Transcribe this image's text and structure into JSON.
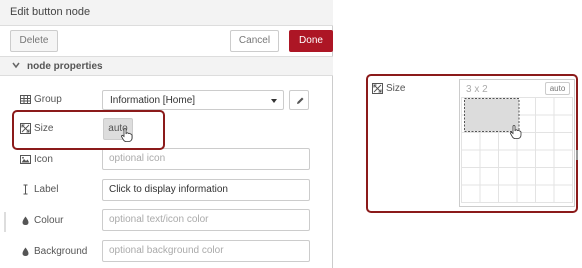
{
  "panel": {
    "title": "Edit button node",
    "delete_label": "Delete",
    "cancel_label": "Cancel",
    "done_label": "Done",
    "section_title": "node properties"
  },
  "properties": {
    "group": {
      "label": "Group",
      "value": "Information [Home]",
      "icon": "table-icon"
    },
    "size": {
      "label": "Size",
      "value": "auto",
      "icon": "size-grid-icon"
    },
    "icon": {
      "label": "Icon",
      "placeholder": "optional icon",
      "icon": "image-icon"
    },
    "label": {
      "label": "Label",
      "value": "Click to display information",
      "icon": "text-cursor-icon"
    },
    "colour": {
      "label": "Colour",
      "placeholder": "optional text/icon color",
      "icon": "droplet-icon"
    },
    "background": {
      "label": "Background",
      "placeholder": "optional background color",
      "icon": "droplet-icon"
    }
  },
  "size_picker": {
    "label": "Size",
    "dimensions": "3 x 2",
    "auto_label": "auto",
    "selected_cols": 3,
    "selected_rows": 2
  },
  "colors": {
    "accent": "#ad1625",
    "highlight_border": "#8b1a1a",
    "header_bg": "#f3f3f3"
  }
}
